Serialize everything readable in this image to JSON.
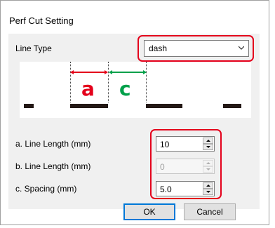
{
  "dialog": {
    "title": "Perf Cut Setting"
  },
  "line_type": {
    "label": "Line Type",
    "value": "dash"
  },
  "preview": {
    "letter_a": "a",
    "letter_c": "c",
    "color_a": "#e4001b",
    "color_c": "#00a04a"
  },
  "fields": [
    {
      "label": "a. Line Length (mm)",
      "value": "10",
      "enabled": true
    },
    {
      "label": "b. Line Length (mm)",
      "value": "0",
      "enabled": false
    },
    {
      "label": "c. Spacing (mm)",
      "value": "5.0",
      "enabled": true
    }
  ],
  "buttons": {
    "ok": "OK",
    "cancel": "Cancel"
  },
  "highlight_color": "#e4001b"
}
